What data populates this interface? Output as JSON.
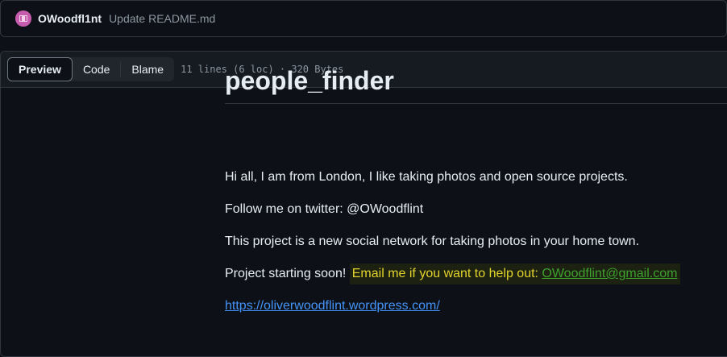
{
  "commit": {
    "author": "OWoodfl1nt",
    "message": "Update README.md",
    "avatar_icon": "avatar-icon"
  },
  "file_header": {
    "tabs": [
      {
        "label": "Preview",
        "active": true
      },
      {
        "label": "Code",
        "active": false
      },
      {
        "label": "Blame",
        "active": false
      }
    ],
    "meta": "11 lines (6 loc) · 320 Bytes"
  },
  "readme": {
    "title": "people_finder",
    "p1": "Hi all, I am from London, I like taking photos and open source projects.",
    "p2": "Follow me on twitter: @OWoodflint",
    "p3": "This project is a new social network for taking photos in your home town.",
    "p4_prefix": "Project starting soon! ",
    "p4_highlight": "Email me if you want to help out: ",
    "p4_email": "OWoodflint@gmail.com",
    "url": "https://oliverwoodflint.wordpress.com/"
  },
  "colors": {
    "background": "#0d1117",
    "link": "#4493f8",
    "email": "#3fa12f",
    "highlight_text": "#e3d42b",
    "avatar": "#c65cae"
  }
}
